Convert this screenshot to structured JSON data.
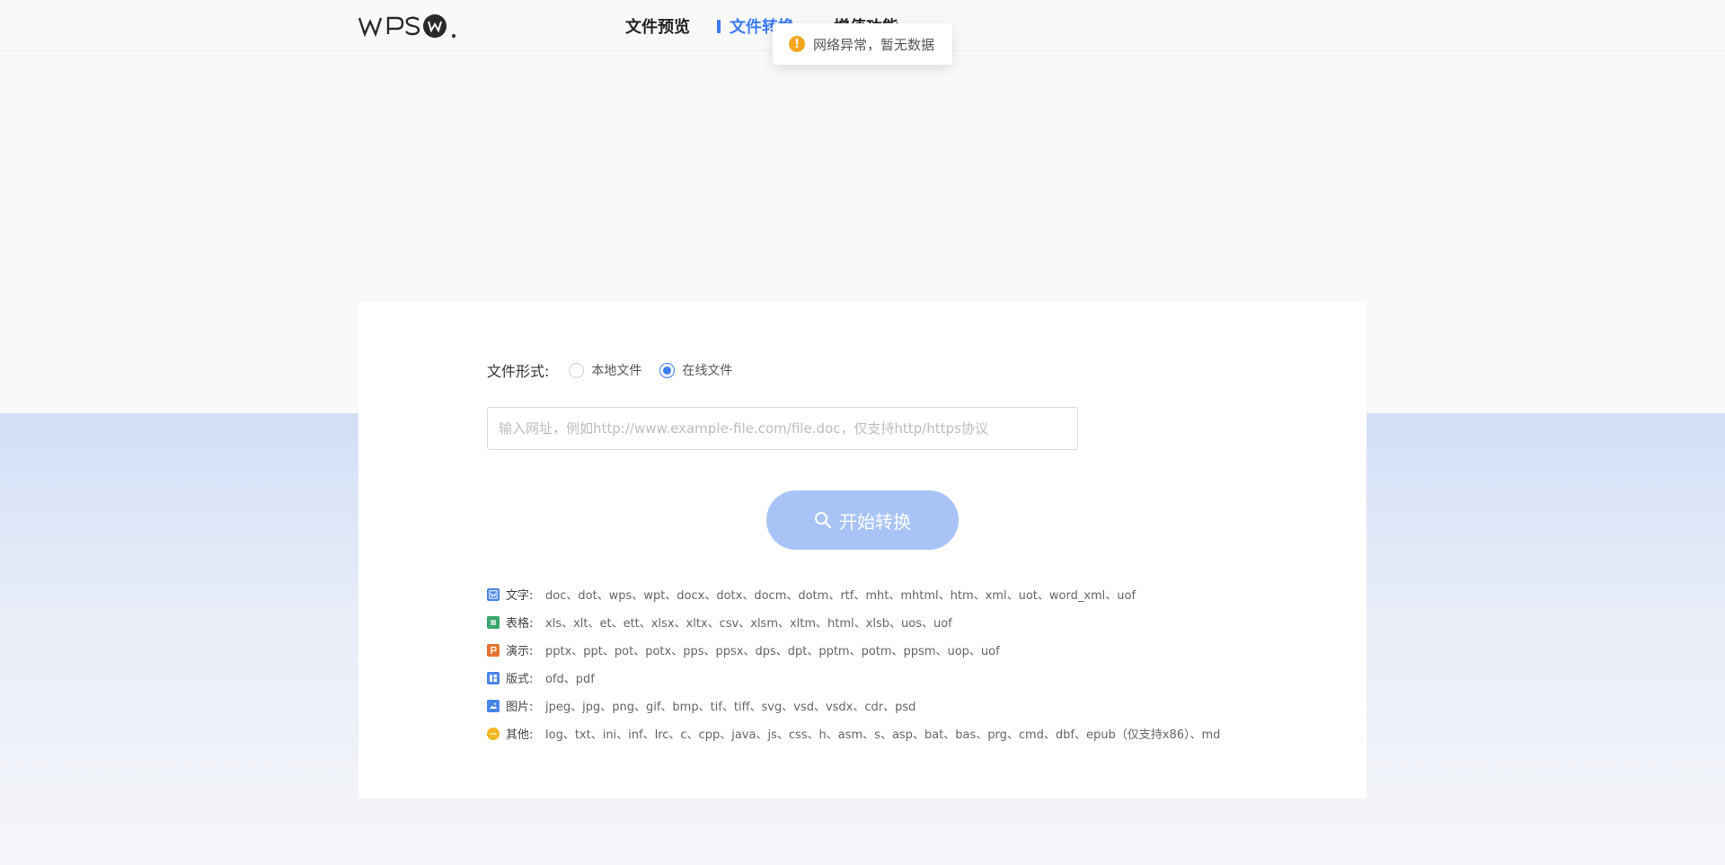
{
  "header": {
    "logo_text": "WPS",
    "nav": [
      {
        "label": "文件预览"
      },
      {
        "label": "文件转换"
      },
      {
        "label": "增值功能"
      }
    ]
  },
  "toast": {
    "message": "网络异常，暂无数据"
  },
  "form": {
    "file_form_label": "文件形式:",
    "options": [
      {
        "label": "本地文件",
        "checked": false
      },
      {
        "label": "在线文件",
        "checked": true
      }
    ],
    "url_placeholder": "输入网址，例如http://www.example-file.com/file.doc，仅支持http/https协议",
    "url_value": "",
    "start_button": "开始转换"
  },
  "formats": [
    {
      "icon": "word-icon",
      "color": "#4a86e8",
      "label": "文字:",
      "list": "doc、dot、wps、wpt、docx、dotx、docm、dotm、rtf、mht、mhtml、htm、xml、uot、word_xml、uof"
    },
    {
      "icon": "sheet-icon",
      "color": "#3aa76d",
      "label": "表格:",
      "list": "xls、xlt、et、ett、xlsx、xltx、csv、xlsm、xltm、html、xlsb、uos、uof"
    },
    {
      "icon": "slides-icon",
      "color": "#e8742f",
      "label": "演示:",
      "list": "pptx、ppt、pot、potx、pps、ppsx、dps、dpt、pptm、potm、ppsm、uop、uof"
    },
    {
      "icon": "layout-icon",
      "color": "#4a86e8",
      "label": "版式:",
      "list": "ofd、pdf"
    },
    {
      "icon": "image-icon",
      "color": "#4a86e8",
      "label": "图片:",
      "list": "jpeg、jpg、png、gif、bmp、tif、tiff、svg、vsd、vsdx、cdr、psd"
    },
    {
      "icon": "other-icon",
      "color": "#f2b824",
      "label": "其他:",
      "list": "log、txt、ini、inf、lrc、c、cpp、java、js、css、h、asm、s、asp、bat、bas、prg、cmd、dbf、epub（仅支持x86）、md"
    }
  ]
}
